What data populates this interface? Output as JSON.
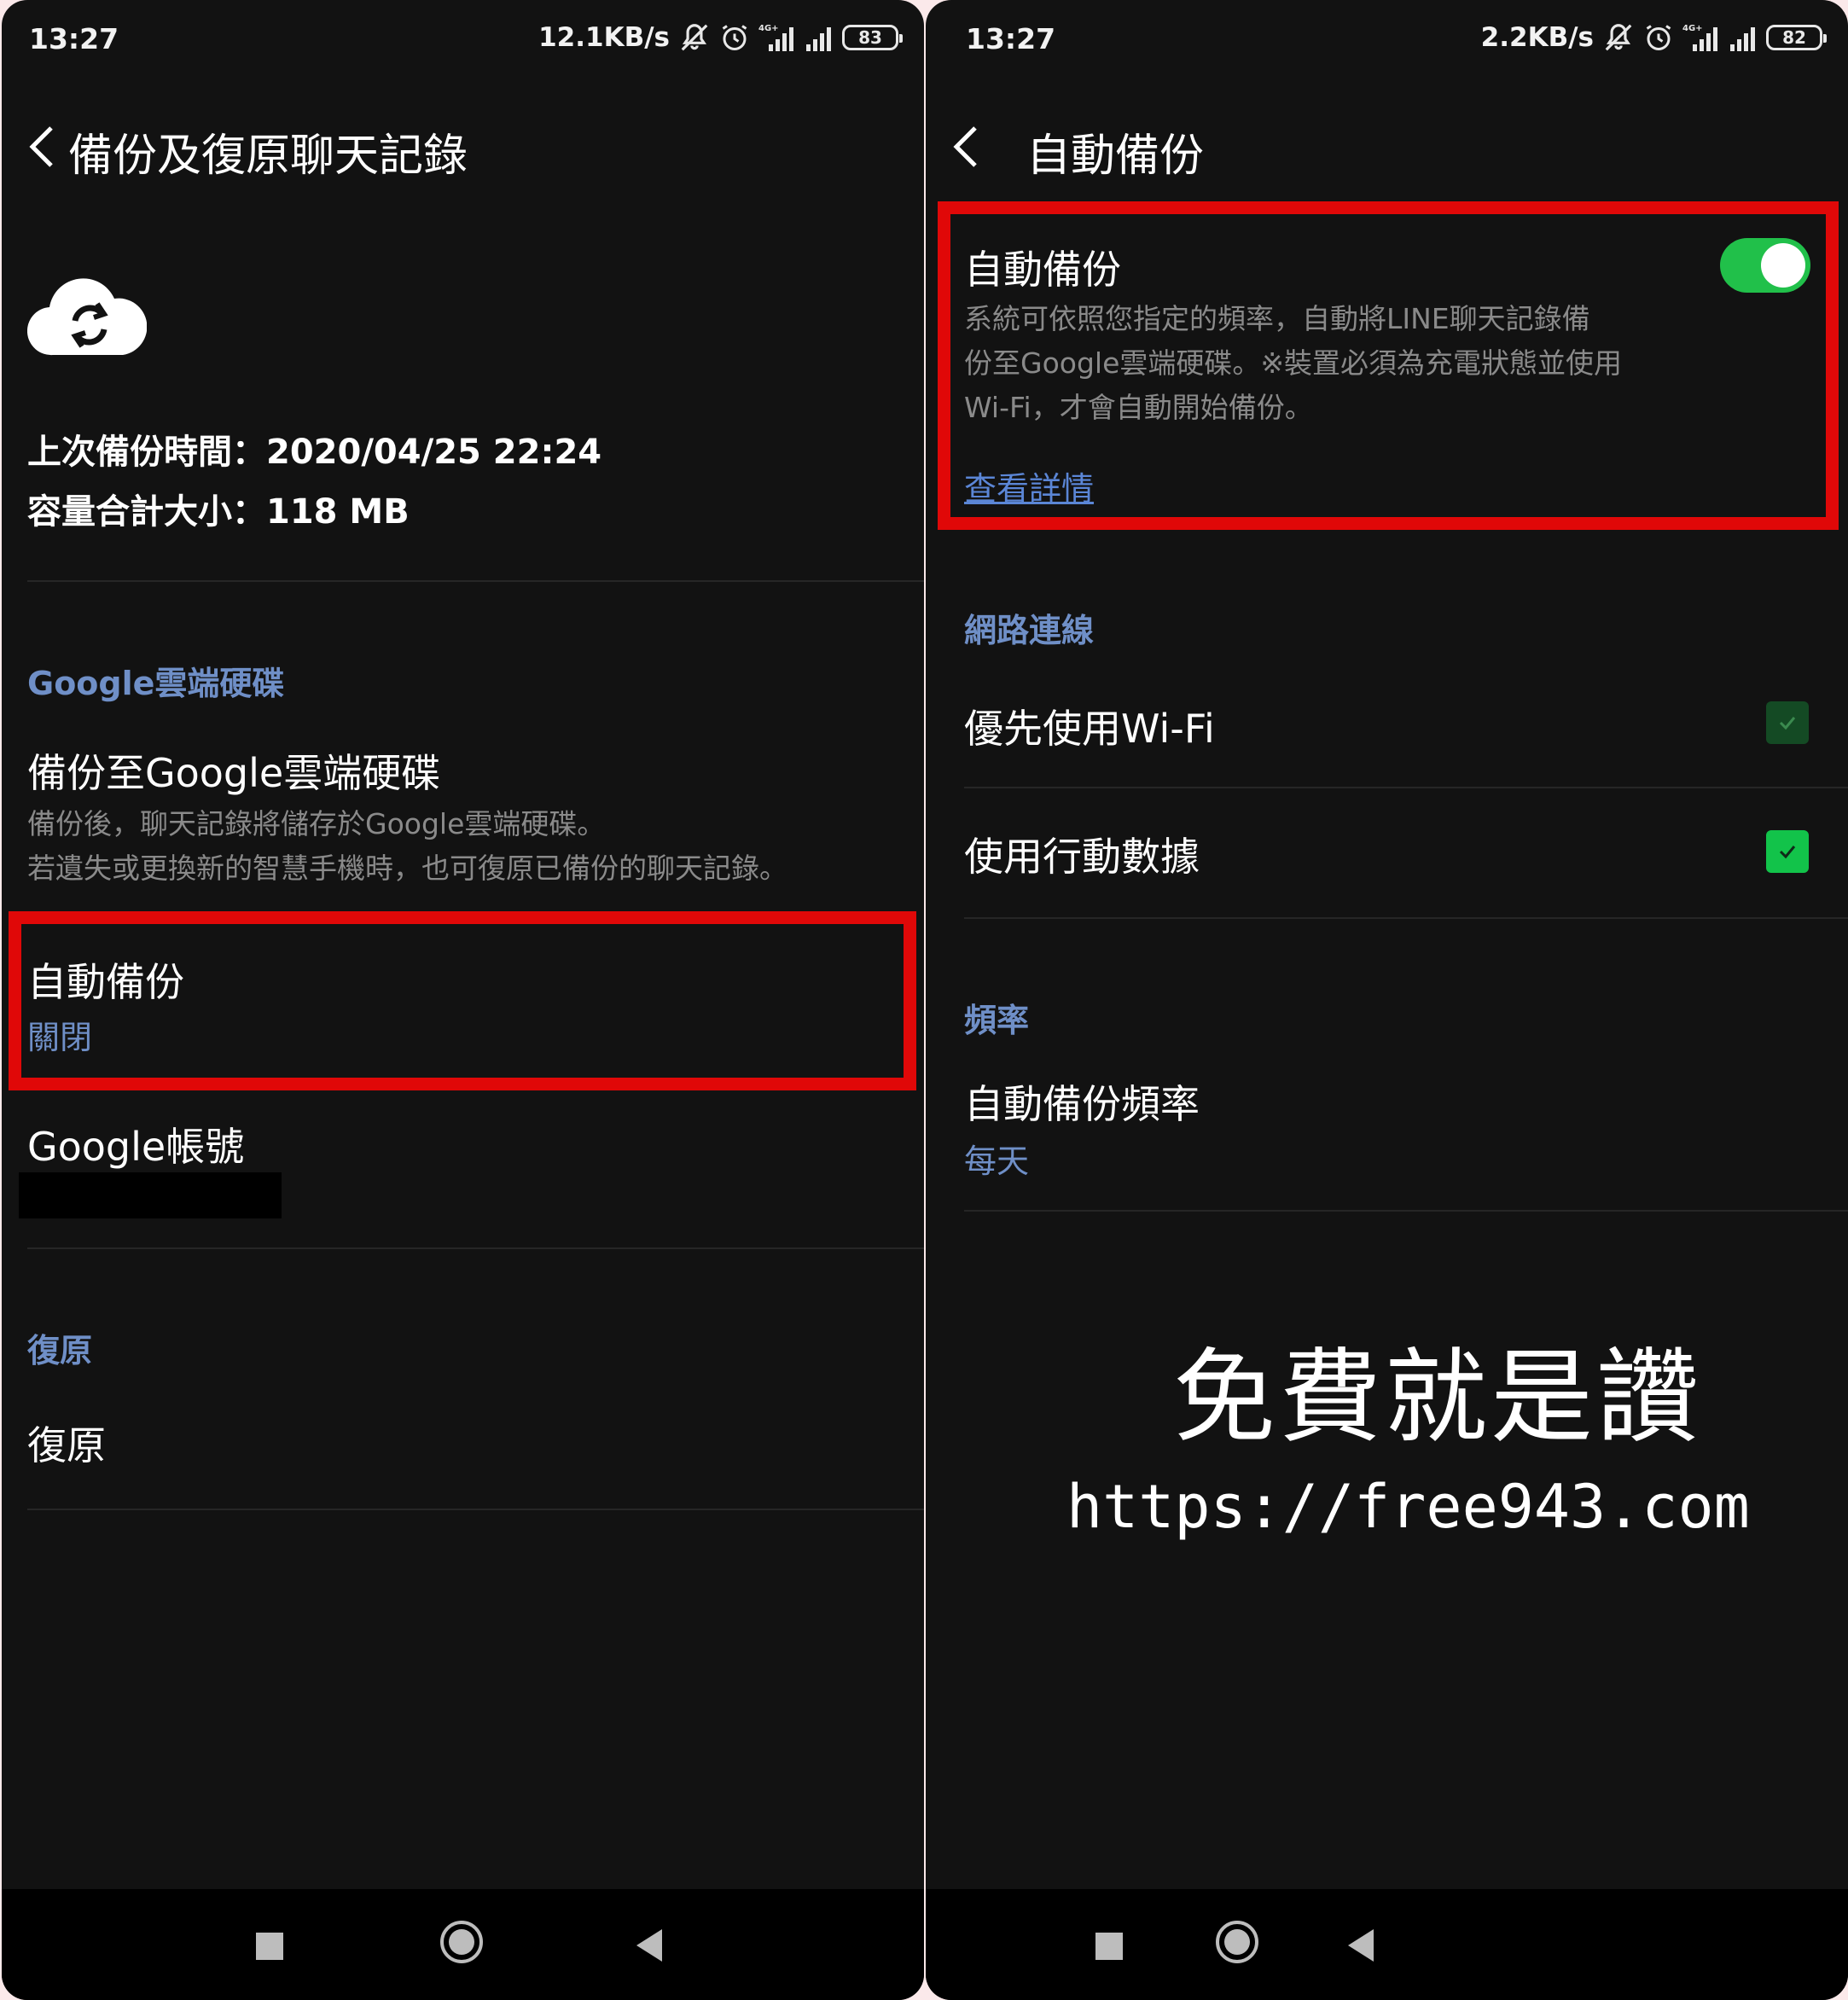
{
  "left": {
    "status_bar": {
      "time": "13:27",
      "net_speed": "12.1KB/s",
      "network_label": "4G+",
      "battery": "83"
    },
    "header": {
      "title": "備份及復原聊天記錄"
    },
    "backup_icon": "cloud-sync-icon",
    "info": {
      "last_backup": "上次備份時間：2020/04/25 22:24",
      "total_size": "容量合計大小：118 MB"
    },
    "google_drive": {
      "section_title": "Google雲端硬碟",
      "backup_title": "備份至Google雲端硬碟",
      "backup_desc_1": "備份後，聊天記錄將儲存於Google雲端硬碟。",
      "backup_desc_2": "若遺失或更換新的智慧手機時，也可復原已備份的聊天記錄。",
      "auto_backup_title": "自動備份",
      "auto_backup_value": "關閉",
      "account_title": "Google帳號"
    },
    "restore": {
      "section_title": "復原",
      "item_title": "復原"
    }
  },
  "right": {
    "status_bar": {
      "time": "13:27",
      "net_speed": "2.2KB/s",
      "network_label": "4G+",
      "battery": "82"
    },
    "header": {
      "title": "自動備份"
    },
    "auto_backup": {
      "title": "自動備份",
      "enabled": true,
      "desc_1": "系統可依照您指定的頻率，自動將LINE聊天記錄備",
      "desc_2": "份至Google雲端硬碟。※裝置必須為充電狀態並使用",
      "desc_3": "Wi-Fi，才會自動開始備份。",
      "details_link": "查看詳情"
    },
    "network": {
      "section_title": "網路連線",
      "wifi_first": "優先使用Wi-Fi",
      "wifi_first_checked": true,
      "mobile_data": "使用行動數據",
      "mobile_data_checked": true
    },
    "frequency": {
      "section_title": "頻率",
      "item_title": "自動備份頻率",
      "item_value": "每天"
    },
    "watermark": {
      "text": "免費就是讚",
      "url": "https://free943.com"
    }
  },
  "colors": {
    "background": "#121212",
    "accent_blue": "#6f8fc7",
    "toggle_green": "#21c04a",
    "highlight_red": "#e00808",
    "desc_gray": "#8a8a8a"
  }
}
